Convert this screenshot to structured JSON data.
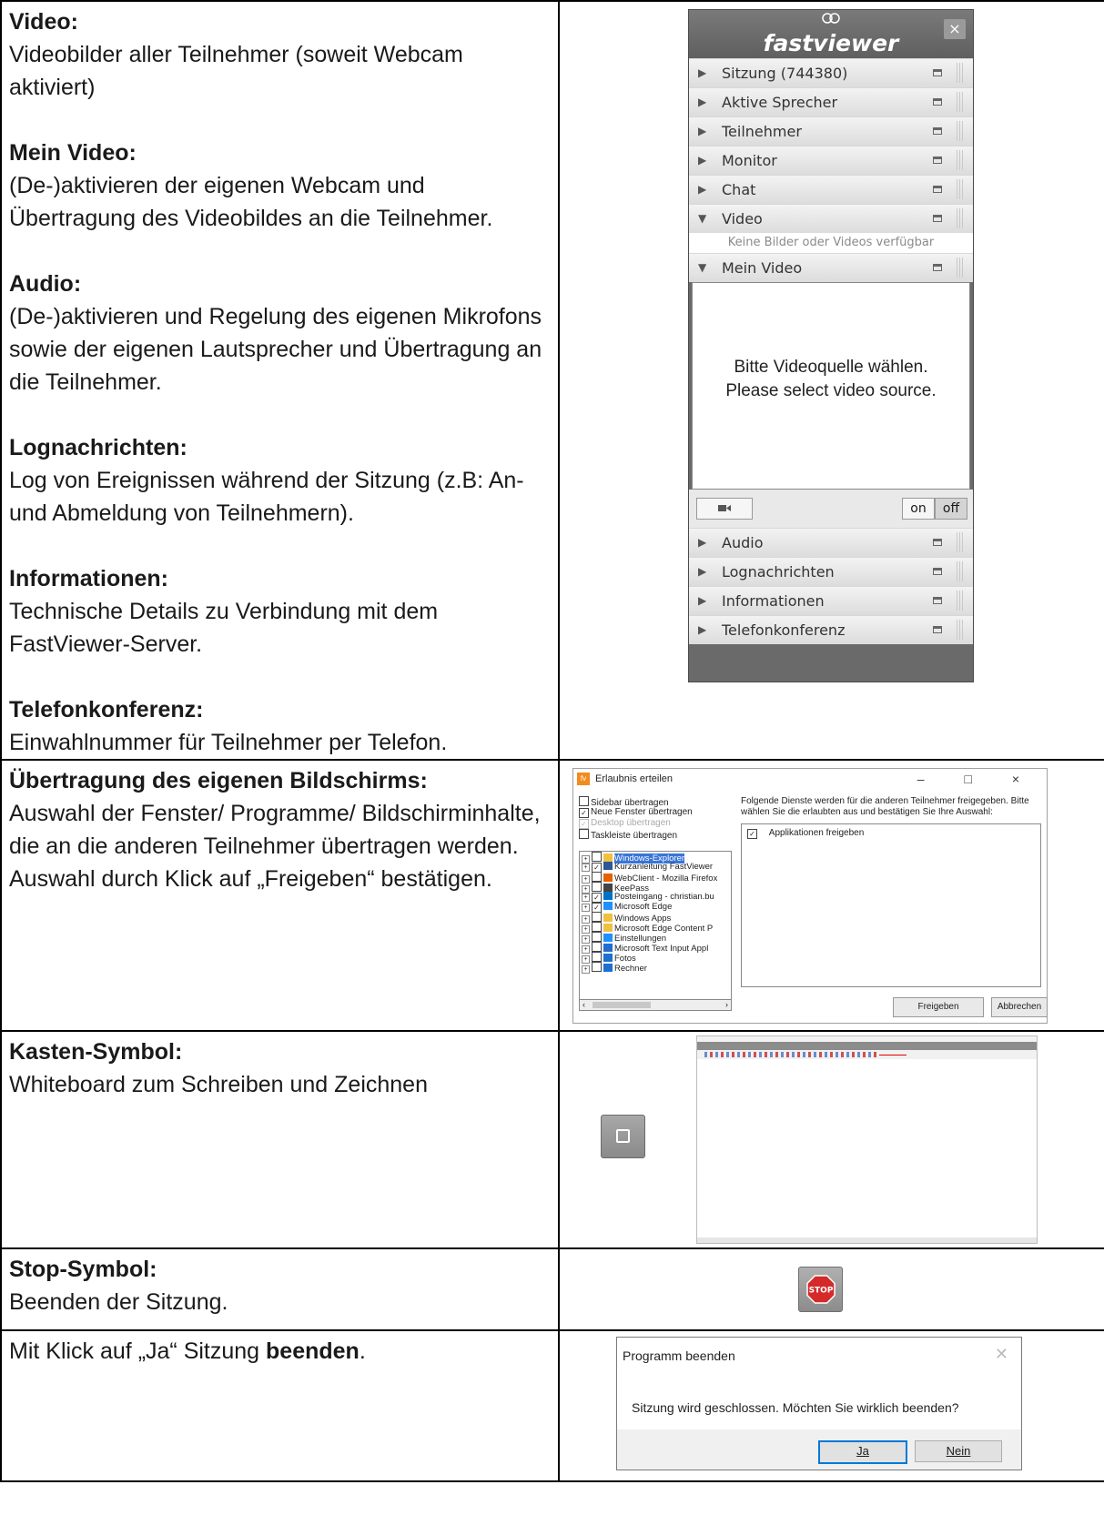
{
  "rows": {
    "r1": {
      "video_heading": "Video:",
      "video_text": "Videobilder aller Teilnehmer (soweit Webcam aktiviert)",
      "meinvideo_heading": "Mein Video:",
      "meinvideo_text": "(De-)aktivieren der eigenen Webcam und Übertragung des Videobildes an die Teilnehmer.",
      "audio_heading": "Audio:",
      "audio_text": "(De-)aktivieren und Regelung des eigenen Mikrofons sowie der eigenen Lautsprecher und Übertragung an die Teilnehmer.",
      "log_heading": "Lognachrichten:",
      "log_text": "Log von Ereignissen während der Sitzung (z.B: An- und Abmeldung von Teilnehmern).",
      "info_heading": "Informationen:",
      "info_text": "Technische Details zu Verbindung mit dem FastViewer-Server.",
      "tel_heading": "Telefonkonferenz:",
      "tel_text": "Einwahlnummer für Teilnehmer per Telefon."
    },
    "r2": {
      "heading": "Übertragung des eigenen Bildschirms:",
      "text": "Auswahl der Fenster/ Programme/ Bildschirminhalte, die an die anderen Teilnehmer übertragen werden. Auswahl durch Klick auf „Freigeben“ bestätigen."
    },
    "r3": {
      "heading": "Kasten-Symbol:",
      "text": "Whiteboard zum Schreiben und Zeichnen"
    },
    "r4": {
      "heading": "Stop-Symbol:",
      "text": "Beenden der Sitzung."
    },
    "r5": {
      "text_pre": "Mit Klick auf „Ja“ Sitzung ",
      "text_bold": "beenden",
      "text_post": "."
    }
  },
  "fastviewer": {
    "logo": "fastviewer",
    "close": "×",
    "sections_top": [
      "Sitzung (744380)",
      "Aktive Sprecher",
      "Teilnehmer",
      "Monitor",
      "Chat"
    ],
    "video_label": "Video",
    "video_note": "Keine Bilder oder Videos verfügbar",
    "meinvideo_label": "Mein Video",
    "video_msg_de": "Bitte Videoquelle wählen.",
    "video_msg_en": "Please select video source.",
    "on": "on",
    "off": "off",
    "sections_bottom": [
      "Audio",
      "Lognachrichten",
      "Informationen",
      "Telefonkonferenz"
    ]
  },
  "erlaubnis": {
    "title": "Erlaubnis erteilen",
    "window_controls": "–  □  ×",
    "options": [
      {
        "label": "Sidebar übertragen",
        "checked": false,
        "disabled": false
      },
      {
        "label": "Neue Fenster übertragen",
        "checked": true,
        "disabled": false
      },
      {
        "label": "Desktop übertragen",
        "checked": true,
        "disabled": true
      },
      {
        "label": "Taskleiste übertragen",
        "checked": false,
        "disabled": false
      }
    ],
    "tree": [
      {
        "label": "Windows-Explorer",
        "checked": false,
        "selected": true,
        "color": "#f0c040"
      },
      {
        "label": "Kurzanleitung FastViewer",
        "checked": true,
        "selected": false,
        "color": "#2b5797"
      },
      {
        "label": "WebClient - Mozilla Firefox",
        "checked": false,
        "selected": false,
        "color": "#e66000"
      },
      {
        "label": "KeePass",
        "checked": false,
        "selected": false,
        "color": "#444444"
      },
      {
        "label": "Posteingang - christian.bu",
        "checked": true,
        "selected": false,
        "color": "#0072c6"
      },
      {
        "label": "Microsoft Edge",
        "checked": true,
        "selected": false,
        "color": "#1e90ff"
      },
      {
        "label": "Windows Apps",
        "checked": false,
        "selected": false,
        "color": "#f0c040"
      },
      {
        "label": "Microsoft Edge Content P",
        "checked": false,
        "selected": false,
        "color": "#f0c040"
      },
      {
        "label": "Einstellungen",
        "checked": false,
        "selected": false,
        "color": "#1e90ff"
      },
      {
        "label": "Microsoft Text Input Appl",
        "checked": false,
        "selected": false,
        "color": "#1e6fd0"
      },
      {
        "label": "Fotos",
        "checked": false,
        "selected": false,
        "color": "#1e6fd0"
      },
      {
        "label": "Rechner",
        "checked": false,
        "selected": false,
        "color": "#1e6fd0"
      }
    ],
    "info": "Folgende Dienste werden für die anderen Teilnehmer freigegeben. Bitte wählen Sie die erlaubten aus und bestätigen Sie Ihre Auswahl:",
    "service": "Applikationen freigeben",
    "freigeben": "Freigeben",
    "abbrechen": "Abbrechen"
  },
  "stop_label": "STOP",
  "beenden": {
    "title": "Programm beenden",
    "message": "Sitzung wird geschlossen. Möchten Sie wirklich beenden?",
    "ja": "Ja",
    "nein": "Nein"
  }
}
